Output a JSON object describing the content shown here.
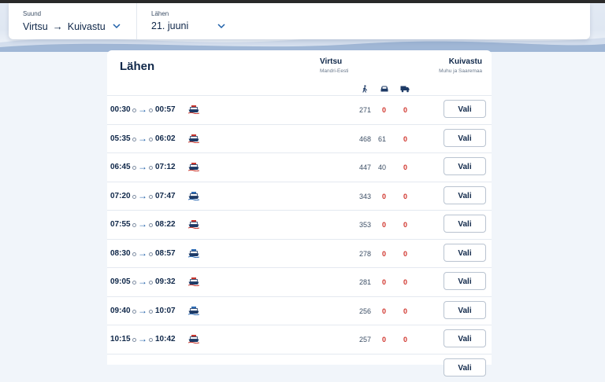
{
  "search": {
    "direction_label": "Suund",
    "from": "Virtsu",
    "to": "Kuivastu",
    "date_label": "Lähen",
    "date_value": "21. juuni"
  },
  "card": {
    "title": "Lähen",
    "col_from_name": "Virtsu",
    "col_from_sub": "Mandri-Eesti",
    "col_to_name": "Kuivastu",
    "col_to_sub": "Muhu ja Saaremaa",
    "vehicle_icons": [
      "pedestrian-icon",
      "car-icon",
      "truck-icon"
    ]
  },
  "colors": {
    "accent": "#1d5fa8",
    "alert": "#d0342c",
    "text": "#0f2749"
  },
  "trips": [
    {
      "dep": "00:30",
      "arr": "00:57",
      "ship": "red",
      "ped": "271",
      "car": "0",
      "truck": "0",
      "button": "Vali"
    },
    {
      "dep": "05:35",
      "arr": "06:02",
      "ship": "red",
      "ped": "468",
      "car": "61",
      "truck": "0",
      "button": "Vali"
    },
    {
      "dep": "06:45",
      "arr": "07:12",
      "ship": "red",
      "ped": "447",
      "car": "40",
      "truck": "0",
      "button": "Vali"
    },
    {
      "dep": "07:20",
      "arr": "07:47",
      "ship": "blue",
      "ped": "343",
      "car": "0",
      "truck": "0",
      "button": "Vali"
    },
    {
      "dep": "07:55",
      "arr": "08:22",
      "ship": "red",
      "ped": "353",
      "car": "0",
      "truck": "0",
      "button": "Vali"
    },
    {
      "dep": "08:30",
      "arr": "08:57",
      "ship": "blue",
      "ped": "278",
      "car": "0",
      "truck": "0",
      "button": "Vali"
    },
    {
      "dep": "09:05",
      "arr": "09:32",
      "ship": "red",
      "ped": "281",
      "car": "0",
      "truck": "0",
      "button": "Vali"
    },
    {
      "dep": "09:40",
      "arr": "10:07",
      "ship": "blue",
      "ped": "256",
      "car": "0",
      "truck": "0",
      "button": "Vali"
    },
    {
      "dep": "10:15",
      "arr": "10:42",
      "ship": "red",
      "ped": "257",
      "car": "0",
      "truck": "0",
      "button": "Vali"
    },
    {
      "dep": "",
      "arr": "",
      "ship": "",
      "ped": "",
      "car": "",
      "truck": "",
      "button": "Vali"
    }
  ]
}
